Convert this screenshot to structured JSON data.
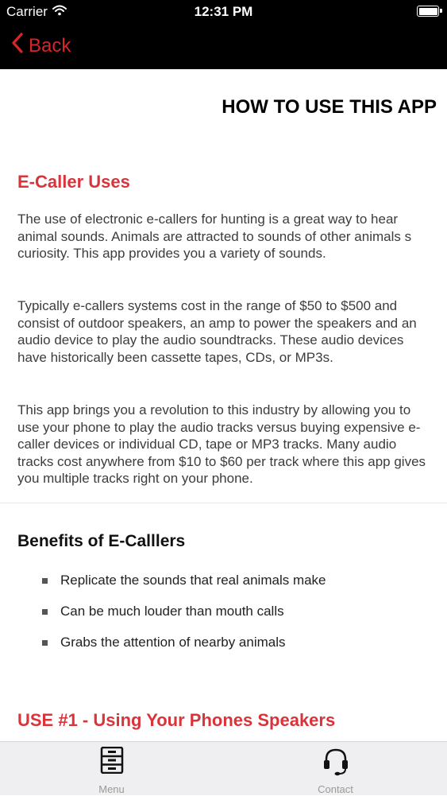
{
  "status_bar": {
    "carrier": "Carrier",
    "time": "12:31 PM",
    "icons": [
      "wifi-icon",
      "battery-icon"
    ]
  },
  "nav": {
    "back_label": "Back",
    "accent_color": "#d9242a"
  },
  "page": {
    "title": "HOW TO USE THIS APP",
    "section1_heading": "E-Caller Uses",
    "paragraph1": "The use of electronic e-callers for hunting is a great way to hear animal sounds.  Animals are attracted to sounds of other animals s curiosity. This app provides you a variety of sounds.",
    "paragraph2": "Typically e-callers systems cost in the range of $50 to $500 and consist of outdoor speakers, an amp to power the speakers and an audio device to play the audio soundtracks.  These audio devices have historically been cassette tapes, CDs, or MP3s.",
    "paragraph3": "This app brings you a revolution to this industry by allowing you to use your phone to play the audio tracks versus buying expensive e-caller devices or individual CD, tape or MP3 tracks.  Many audio tracks cost anywhere from $10 to $60 per track where this app gives you multiple tracks right on your phone.",
    "section2_heading": "Benefits of E-Calllers",
    "benefits": [
      "Replicate the sounds that real animals make",
      "Can be much louder than mouth calls",
      "Grabs the attention of nearby animals"
    ],
    "section3_heading": "USE #1 - Using Your Phones Speakers"
  },
  "tab_bar": {
    "tabs": [
      {
        "label": "Menu",
        "icon": "cabinet-icon"
      },
      {
        "label": "Contact",
        "icon": "headset-icon"
      }
    ]
  }
}
